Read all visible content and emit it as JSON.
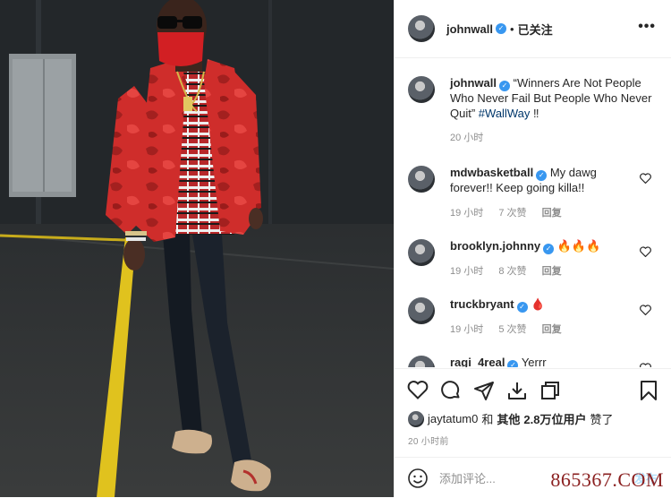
{
  "post_header": {
    "username": "johnwall",
    "separator": "•",
    "follow_state": "已关注",
    "more": "•••"
  },
  "caption": {
    "username": "johnwall",
    "text": "“Winners Are Not People Who Never Fail But People Who Never Quit”",
    "hashtag": "#WallWay",
    "suffix": "‼",
    "time": "20 小时"
  },
  "comments": [
    {
      "username": "mdwbasketball",
      "text": "My dawg forever!! Keep going killa!!",
      "time": "19 小时",
      "likes": "7 次赞",
      "reply": "回复"
    },
    {
      "username": "brooklyn.johnny",
      "text": "🔥🔥🔥",
      "time": "19 小时",
      "likes": "8 次赞",
      "reply": "回复"
    },
    {
      "username": "truckbryant",
      "text": "🩸",
      "time": "19 小时",
      "likes": "5 次赞",
      "reply": "回复"
    },
    {
      "username": "ragi_4real",
      "text": "Yerrr"
    }
  ],
  "likes": {
    "first_user": "jaytatum0",
    "connector": "和",
    "others_label": "其他",
    "count": "2.8万",
    "users_label": "位用户",
    "liked": "赞了"
  },
  "post_time": "20 小时前",
  "add_comment": {
    "placeholder": "添加评论...",
    "post_label": "发布"
  },
  "watermark": "865367.COM",
  "colors": {
    "link": "#00376b",
    "verified": "#3897f0",
    "muted": "#8e8e8e",
    "jacket_red": "#d8312c"
  },
  "icons": [
    "heart-icon",
    "comment-icon",
    "share-icon",
    "download-icon",
    "repost-icon",
    "bookmark-icon",
    "smile-icon",
    "verified-icon"
  ]
}
